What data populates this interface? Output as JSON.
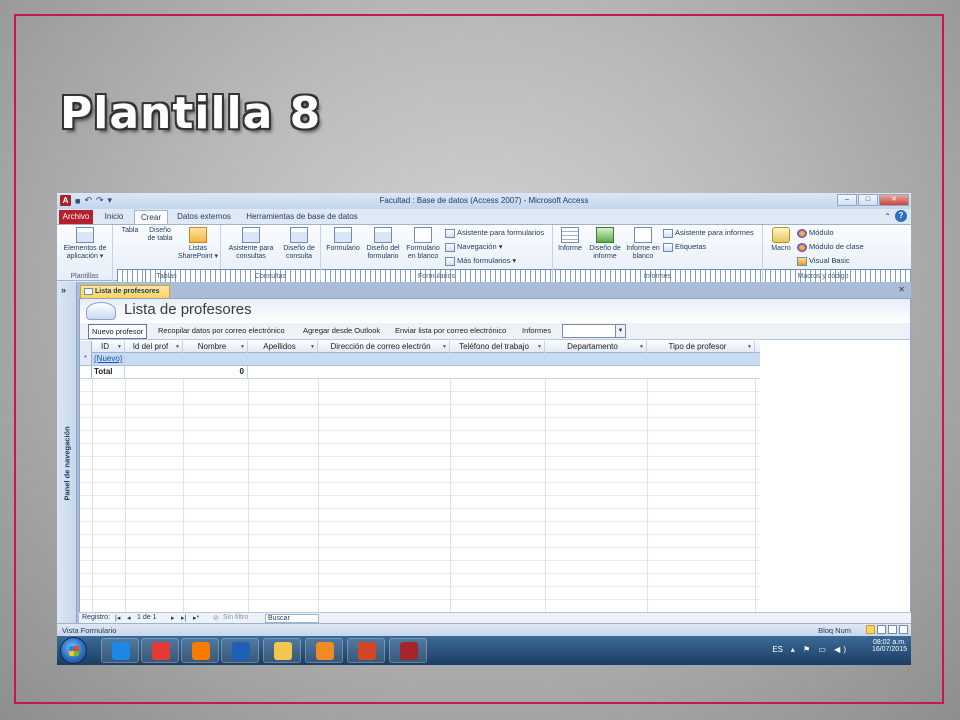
{
  "slide": {
    "title": "Plantilla 8"
  },
  "window": {
    "title": "Facultad : Base de datos (Access 2007) - Microsoft Access",
    "app_icon": "A",
    "controls": [
      "–",
      "□",
      "✕"
    ]
  },
  "ribbon_tabs": [
    "Archivo",
    "Inicio",
    "Crear",
    "Datos externos",
    "Herramientas de base de datos"
  ],
  "ribbon": {
    "groups": {
      "plantillas": {
        "label": "Plantillas",
        "elementos": "Elementos de aplicación ▾"
      },
      "tablas": {
        "label": "Tablas",
        "tabla": "Tabla",
        "diseno_tabla": "Diseño de tabla",
        "listas": "Listas SharePoint ▾"
      },
      "consultas": {
        "label": "Consultas",
        "asistente": "Asistente para consultas",
        "diseno": "Diseño de consulta"
      },
      "formularios": {
        "label": "Formularios",
        "formulario": "Formulario",
        "diseno": "Diseño del formulario",
        "blanco": "Formulario en blanco",
        "asistente": "Asistente para formularios",
        "navegacion": "Navegación ▾",
        "mas": "Más formularios ▾"
      },
      "informes": {
        "label": "Informes",
        "informe": "Informe",
        "diseno": "Diseño de informe",
        "blanco": "Informe en blanco",
        "asistente": "Asistente para informes",
        "etiquetas": "Etiquetas"
      },
      "macros": {
        "label": "Macros y código",
        "macro": "Macro",
        "modulo": "Módulo",
        "modulo_clase": "Módulo de clase",
        "vb": "Visual Basic"
      }
    }
  },
  "nav_pane": {
    "toggle": "»",
    "label": "Panel de navegación"
  },
  "document": {
    "tab_label": "Lista de profesores",
    "close": "✕",
    "form_title": "Lista de profesores",
    "commands": {
      "nuevo": "Nuevo profesor",
      "recopilar": "Recopilar datos por correo electrónico",
      "agregar": "Agregar desde Outlook",
      "enviar": "Enviar lista por correo electrónico",
      "informes_label": "Informes",
      "informes_value": ""
    },
    "columns": [
      "ID",
      "Id del prof",
      "Nombre",
      "Apellidos",
      "Dirección de correo electrón",
      "Teléfono del trabajo",
      "Departamento",
      "Tipo de profesor"
    ],
    "new_row": {
      "marker": "*",
      "id": "(Nuevo)"
    },
    "total_row": {
      "label": "Total",
      "nombre_total": "0"
    },
    "record_nav": {
      "label": "Registro:",
      "position": "1 de 1",
      "filter": "Sin filtro",
      "search": "Buscar"
    }
  },
  "statusbar": {
    "left": "Vista Formulario",
    "right": "Bloq Num"
  },
  "taskbar": {
    "lang": "ES",
    "time": "08:02 a.m.",
    "date": "16/07/2015",
    "apps": [
      {
        "name": "ie",
        "color": "#1e88e5"
      },
      {
        "name": "chrome",
        "color": "#e53935"
      },
      {
        "name": "firefox",
        "color": "#f57c00"
      },
      {
        "name": "word",
        "color": "#1f5fb8"
      },
      {
        "name": "explorer",
        "color": "#f3c64d"
      },
      {
        "name": "media",
        "color": "#f08a24"
      },
      {
        "name": "powerpoint",
        "color": "#d24726"
      },
      {
        "name": "access",
        "color": "#a4262c"
      }
    ]
  }
}
